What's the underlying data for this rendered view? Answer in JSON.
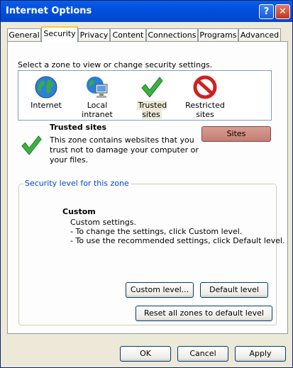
{
  "window": {
    "title": "Internet Options"
  },
  "tabs": [
    "General",
    "Security",
    "Privacy",
    "Content",
    "Connections",
    "Programs",
    "Advanced"
  ],
  "security": {
    "prompt": "Select a zone to view or change security settings.",
    "zones": [
      {
        "label": "Internet",
        "icon": "globe-icon"
      },
      {
        "label": "Local intranet",
        "icon": "intranet-computer-icon"
      },
      {
        "label": "Trusted sites",
        "icon": "checkmark-icon"
      },
      {
        "label": "Restricted sites",
        "icon": "restricted-icon"
      }
    ],
    "selected_zone_title": "Trusted sites",
    "selected_zone_desc_1": "This zone contains websites that you",
    "selected_zone_desc_2": "trust not to damage your computer or",
    "selected_zone_desc_3": "your files.",
    "sites_button": "Sites",
    "group_title": "Security level for this zone",
    "level_title": "Custom",
    "level_line_1": "Custom settings.",
    "level_line_2": "- To change the settings, click Custom level.",
    "level_line_3": "- To use the recommended settings, click Default level.",
    "custom_level_button": "Custom level...",
    "default_level_button": "Default level",
    "reset_button": "Reset all zones to default level"
  },
  "footer": {
    "ok": "OK",
    "cancel": "Cancel",
    "apply": "Apply"
  },
  "colors": {
    "title_bar": "#0054e3",
    "tab_highlight": "#ffc83c",
    "group_title": "#0046d5",
    "sites_button": "#c98a80"
  }
}
